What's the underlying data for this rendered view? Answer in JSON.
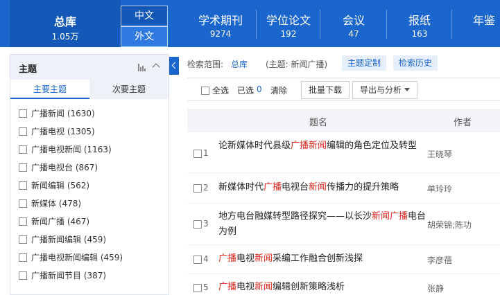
{
  "header": {
    "total": {
      "label": "总库",
      "count": "1.05万"
    },
    "lang": {
      "zh": "中文",
      "wai": "外文"
    },
    "nav": [
      {
        "label": "学术期刊",
        "count": "9274"
      },
      {
        "label": "学位论文",
        "count": "192"
      },
      {
        "label": "会议",
        "count": "47"
      },
      {
        "label": "报纸",
        "count": "163"
      },
      {
        "label": "年鉴",
        "count": ""
      }
    ]
  },
  "sidebar": {
    "title": "主题",
    "tabs": {
      "main": "主要主题",
      "sub": "次要主题"
    },
    "facets": [
      "广播新闻 (1630)",
      "广播电视 (1305)",
      "广播电视新闻 (1163)",
      "广播电视台 (867)",
      "新闻编辑 (562)",
      "新媒体 (478)",
      "新闻广播 (467)",
      "广播新闻编辑 (459)",
      "广播电视新闻编辑 (459)",
      "广播新闻节目 (387)"
    ]
  },
  "search": {
    "scope_label": "检索范围:",
    "scope_value": "总库",
    "topic": "(主题: 新闻广播)",
    "custom_btn": "主题定制",
    "history_btn": "检索历史"
  },
  "toolbar": {
    "select_all": "全选",
    "selected_label": "已选",
    "selected_count": "0",
    "clear": "清除",
    "batch_download": "批量下载",
    "export": "导出与分析"
  },
  "table": {
    "col_title": "题名",
    "col_author": "作者",
    "rows": [
      {
        "num": "1",
        "author": "王晓琴",
        "segments": [
          {
            "t": "论新媒体时代县级"
          },
          {
            "t": "广播新闻",
            "hl": true
          },
          {
            "t": "编辑的角色定位及转型"
          }
        ]
      },
      {
        "num": "2",
        "author": "单玲玲",
        "segments": [
          {
            "t": "新媒体时代"
          },
          {
            "t": "广播",
            "hl": true
          },
          {
            "t": "电视台"
          },
          {
            "t": "新闻",
            "hl": true
          },
          {
            "t": "传播力的提升策略"
          }
        ]
      },
      {
        "num": "3",
        "author": "胡荣锦;陈功",
        "segments": [
          {
            "t": "地方电台融媒转型路径探究——以长沙"
          },
          {
            "t": "新闻广播",
            "hl": true
          },
          {
            "t": "电台为例"
          }
        ]
      },
      {
        "num": "4",
        "author": "李彦蓓",
        "segments": [
          {
            "t": "广播",
            "hl": true
          },
          {
            "t": "电视"
          },
          {
            "t": "新闻",
            "hl": true
          },
          {
            "t": "采编工作融合创新浅探"
          }
        ]
      },
      {
        "num": "5",
        "author": "张静",
        "segments": [
          {
            "t": "广播",
            "hl": true
          },
          {
            "t": "电视"
          },
          {
            "t": "新闻",
            "hl": true
          },
          {
            "t": "编辑创新策略浅析"
          }
        ]
      }
    ]
  }
}
